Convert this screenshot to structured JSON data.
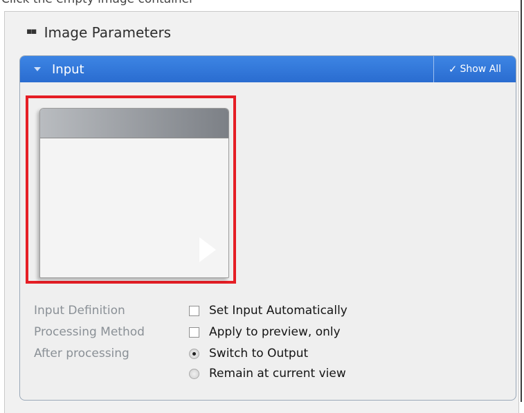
{
  "top_cut_text": "Click the empty image container",
  "panel": {
    "title": "Image Parameters",
    "grip_icon": "grip-dots-icon"
  },
  "input_group": {
    "title": "Input",
    "show_all_label": "Show All",
    "check_glyph": "✓",
    "header_color": "#2f74d9",
    "highlight_color": "#e51e25"
  },
  "form": {
    "input_definition": {
      "label": "Input Definition",
      "control_label": "Set Input Automatically",
      "checked": false
    },
    "processing_method": {
      "label": "Processing Method",
      "control_label": "Apply to preview, only",
      "checked": false
    },
    "after_processing": {
      "label": "After processing",
      "options": [
        {
          "label": "Switch to Output",
          "selected": true
        },
        {
          "label": "Remain at current view",
          "selected": false
        }
      ]
    }
  }
}
